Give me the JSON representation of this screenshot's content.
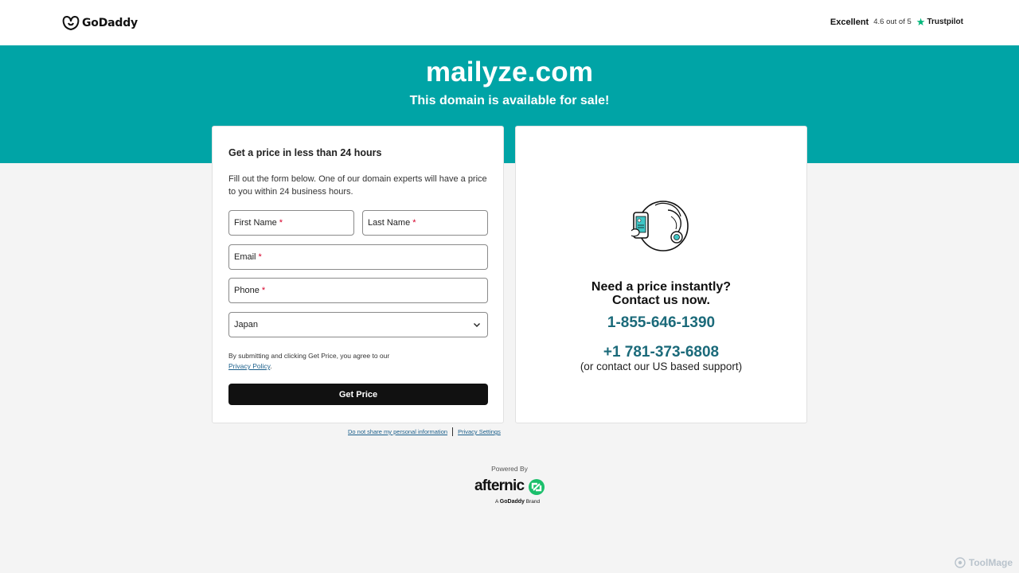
{
  "header": {
    "logo_text": "GoDaddy",
    "trust_label": "Excellent",
    "trust_score": "4.6 out of 5",
    "trust_brand": "Trustpilot"
  },
  "hero": {
    "domain": "mailyze.com",
    "subtitle": "This domain is available for sale!"
  },
  "form": {
    "title": "Get a price in less than 24 hours",
    "description": "Fill out the form below. One of our domain experts will have a price to you within 24 business hours.",
    "first_name_label": "First Name",
    "last_name_label": "Last Name",
    "email_label": "Email",
    "phone_label": "Phone",
    "required_mark": "*",
    "country_value": "Japan",
    "agree_text": "By submitting and clicking Get Price, you agree to our",
    "privacy_link": "Privacy Policy",
    "agree_end": ".",
    "submit_label": "Get Price"
  },
  "contact": {
    "heading_line1": "Need a price instantly?",
    "heading_line2": "Contact us now.",
    "phone_primary": "1-855-646-1390",
    "phone_secondary": "+1 781-373-6808",
    "support_note": "(or contact our US based support)"
  },
  "footer": {
    "do_not_share": "Do not share my personal information",
    "privacy_settings": "Privacy Settings",
    "powered_by": "Powered By",
    "afternic_word": "afternic",
    "brand_prefix": "A",
    "brand_name": "GoDaddy",
    "brand_suffix": "Brand"
  },
  "watermark": "ToolMage",
  "colors": {
    "teal": "#00a4a6",
    "phone_text": "#1b6a7a",
    "button": "#111111",
    "trustpilot_star": "#00b67a",
    "afternic_green": "#1bbf6b"
  }
}
